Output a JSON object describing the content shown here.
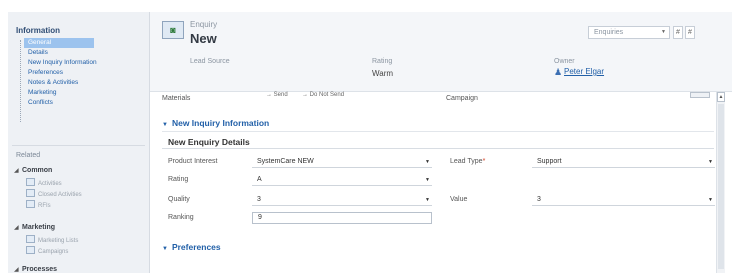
{
  "sidebar": {
    "heading": "Information",
    "items": [
      {
        "label": "General"
      },
      {
        "label": "Details"
      },
      {
        "label": "New Inquiry Information"
      },
      {
        "label": "Preferences"
      },
      {
        "label": "Notes & Activities"
      },
      {
        "label": "Marketing"
      },
      {
        "label": "Conflicts"
      }
    ],
    "related_heading": "Related",
    "common_group": "Common",
    "common_items": [
      "Activities",
      "Closed Activities",
      "RFIs"
    ],
    "marketing_group": "Marketing",
    "marketing_items": [
      "Marketing Lists",
      "Campaigns"
    ],
    "processes_group": "Processes"
  },
  "header": {
    "entity_type": "Enquiry",
    "record_title": "New",
    "lead_source_label": "Lead Source",
    "rating_label": "Rating",
    "rating_value": "Warm",
    "owner_label": "Owner",
    "owner_value": "Peter Elgar",
    "form_selector": "Enquiries"
  },
  "form": {
    "top_row": {
      "materials_label": "Materials",
      "send_option": "Send",
      "do_not_send_option": "Do Not Send",
      "campaign_label": "Campaign"
    },
    "section_new_inquiry": "New Inquiry Information",
    "subsection_title": "New Enquiry Details",
    "fields": {
      "product_interest_label": "Product Interest",
      "product_interest_value": "SystemCare NEW",
      "lead_type_label": "Lead Type",
      "lead_type_value": "Support",
      "rating_label": "Rating",
      "rating_value": "A",
      "quality_label": "Quality",
      "quality_value": "3",
      "value_label": "Value",
      "value_value": "3",
      "ranking_label": "Ranking",
      "ranking_value": "9"
    },
    "section_preferences": "Preferences"
  },
  "colors": {
    "accent_link": "#2260a8",
    "active_nav": "#9cc3ee",
    "required_marker": "#d23a1e"
  }
}
